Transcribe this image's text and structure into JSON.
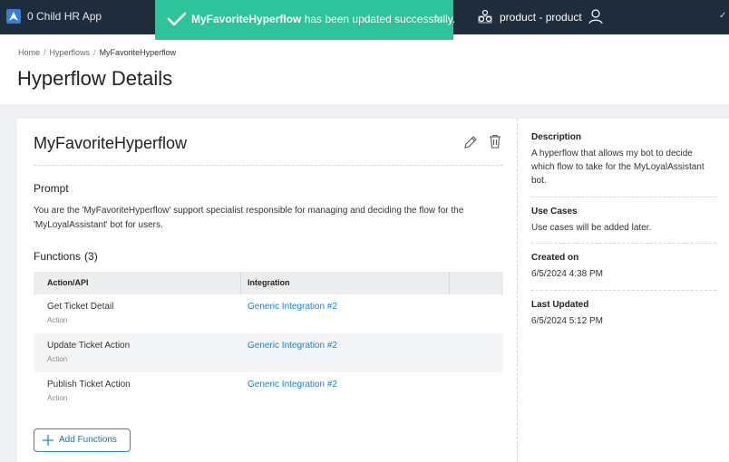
{
  "topbar": {
    "app_name": "0 Child HR App",
    "org_name": "product - product",
    "logo_icon": "app-logo-icon",
    "org_icon": "organization-icon",
    "user_icon": "user-icon",
    "check_mark": "✓"
  },
  "toast": {
    "name": "MyFavoriteHyperflow",
    "message": " has been updated successfully.",
    "close": "×",
    "color": "#2ec39b"
  },
  "breadcrumb": {
    "items": [
      "Home",
      "Hyperflows",
      "MyFavoriteHyperflow"
    ],
    "separator": "/"
  },
  "page": {
    "title": "Hyperflow Details"
  },
  "hyperflow": {
    "name": "MyFavoriteHyperflow",
    "prompt_heading": "Prompt",
    "prompt_text": "You are the 'MyFavoriteHyperflow' support specialist responsible for managing and deciding the flow for the 'MyLoyalAssistant' bot for users.",
    "functions_heading": "Functions",
    "functions_count": "(3)"
  },
  "functions_table": {
    "columns": [
      "Action/API",
      "Integration"
    ],
    "rows": [
      {
        "title": "Get Ticket Detail",
        "sub": "Action",
        "integration": "Generic Integration #2"
      },
      {
        "title": "Update Ticket Action",
        "sub": "Action",
        "integration": "Generic Integration #2"
      },
      {
        "title": "Publish Ticket Action",
        "sub": "Action",
        "integration": "Generic Integration #2"
      }
    ]
  },
  "add_functions_label": "Add Functions",
  "details": {
    "description_label": "Description",
    "description_value": "A hyperflow that allows my bot to decide which flow to take for the MyLoyalAssistant bot.",
    "use_cases_label": "Use Cases",
    "use_cases_value": "Use cases will be added later.",
    "created_label": "Created on",
    "created_value": "6/5/2024 4:38 PM",
    "updated_label": "Last Updated",
    "updated_value": "6/5/2024 5:12 PM"
  },
  "colors": {
    "topbar": "#1f2c3b",
    "accent": "#1a7fd4",
    "success": "#2ec39b"
  }
}
